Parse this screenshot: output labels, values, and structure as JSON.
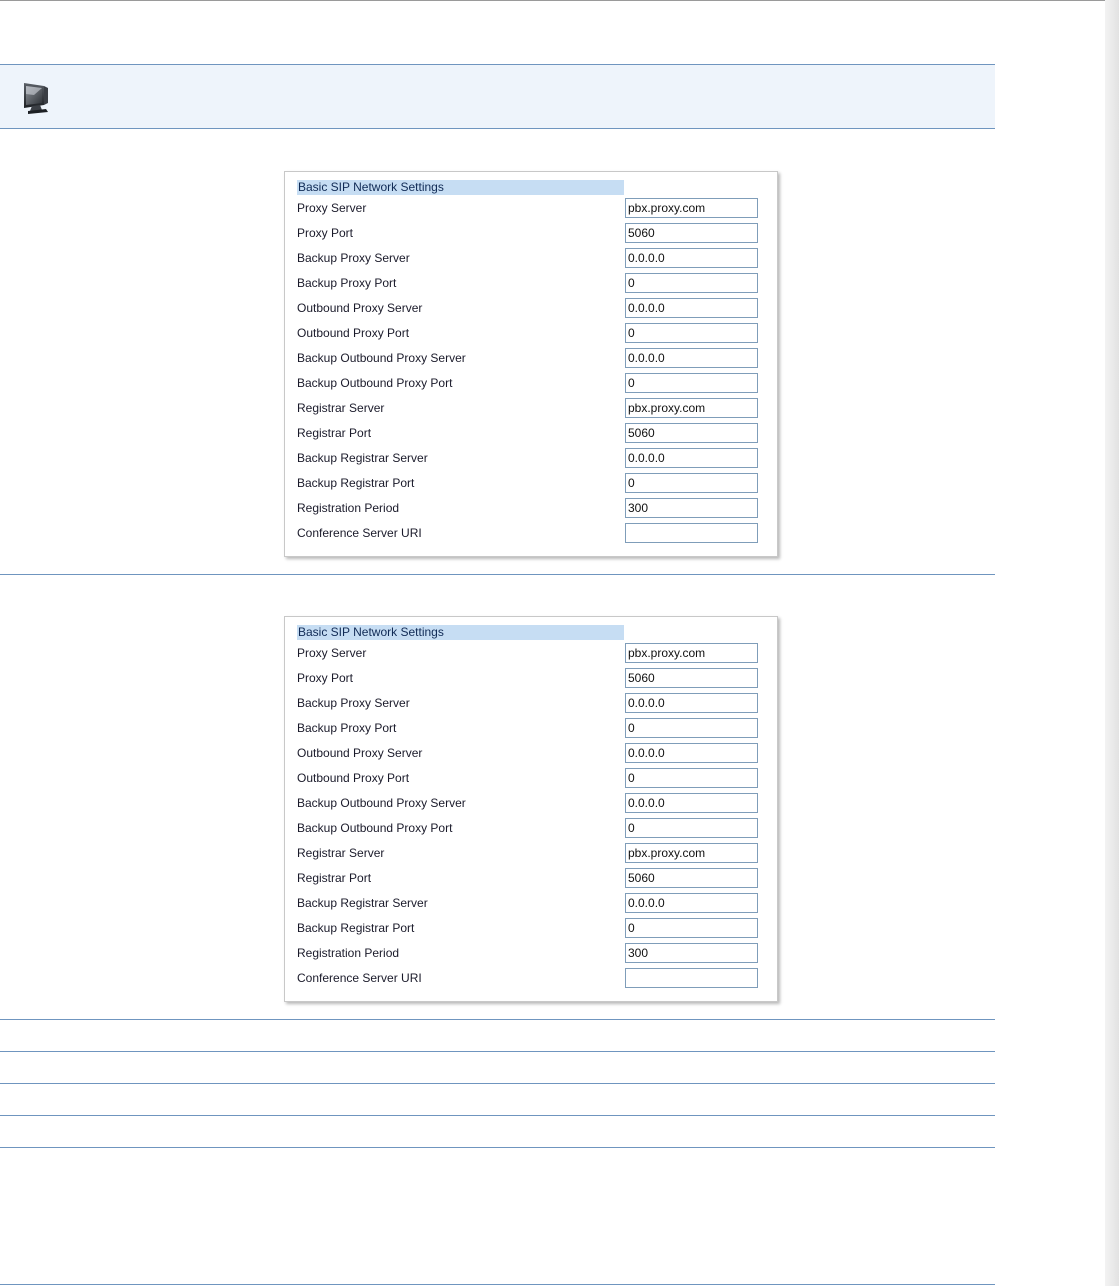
{
  "header": {
    "icon": "computer-monitor-icon"
  },
  "colors": {
    "rule": "#6f95bf",
    "banner_bg": "#eef4fb",
    "section_header_bg": "#c6ddf3"
  },
  "panels": [
    {
      "title": "Basic SIP Network Settings",
      "rows": [
        {
          "label": "Proxy Server",
          "value": "pbx.proxy.com"
        },
        {
          "label": "Proxy Port",
          "value": "5060"
        },
        {
          "label": "Backup Proxy Server",
          "value": "0.0.0.0"
        },
        {
          "label": "Backup Proxy Port",
          "value": "0"
        },
        {
          "label": "Outbound Proxy Server",
          "value": "0.0.0.0"
        },
        {
          "label": "Outbound Proxy Port",
          "value": "0"
        },
        {
          "label": "Backup Outbound Proxy Server",
          "value": "0.0.0.0"
        },
        {
          "label": "Backup Outbound Proxy Port",
          "value": "0"
        },
        {
          "label": "Registrar Server",
          "value": "pbx.proxy.com"
        },
        {
          "label": "Registrar Port",
          "value": "5060"
        },
        {
          "label": "Backup Registrar Server",
          "value": "0.0.0.0"
        },
        {
          "label": "Backup Registrar Port",
          "value": "0"
        },
        {
          "label": "Registration Period",
          "value": "300"
        },
        {
          "label": "Conference Server URI",
          "value": ""
        }
      ]
    },
    {
      "title": "Basic SIP Network Settings",
      "rows": [
        {
          "label": "Proxy Server",
          "value": "pbx.proxy.com"
        },
        {
          "label": "Proxy Port",
          "value": "5060"
        },
        {
          "label": "Backup Proxy Server",
          "value": "0.0.0.0"
        },
        {
          "label": "Backup Proxy Port",
          "value": "0"
        },
        {
          "label": "Outbound Proxy Server",
          "value": "0.0.0.0"
        },
        {
          "label": "Outbound Proxy Port",
          "value": "0"
        },
        {
          "label": "Backup Outbound Proxy Server",
          "value": "0.0.0.0"
        },
        {
          "label": "Backup Outbound Proxy Port",
          "value": "0"
        },
        {
          "label": "Registrar Server",
          "value": "pbx.proxy.com"
        },
        {
          "label": "Registrar Port",
          "value": "5060"
        },
        {
          "label": "Backup Registrar Server",
          "value": "0.0.0.0"
        },
        {
          "label": "Backup Registrar Port",
          "value": "0"
        },
        {
          "label": "Registration Period",
          "value": "300"
        },
        {
          "label": "Conference Server URI",
          "value": ""
        }
      ]
    }
  ]
}
